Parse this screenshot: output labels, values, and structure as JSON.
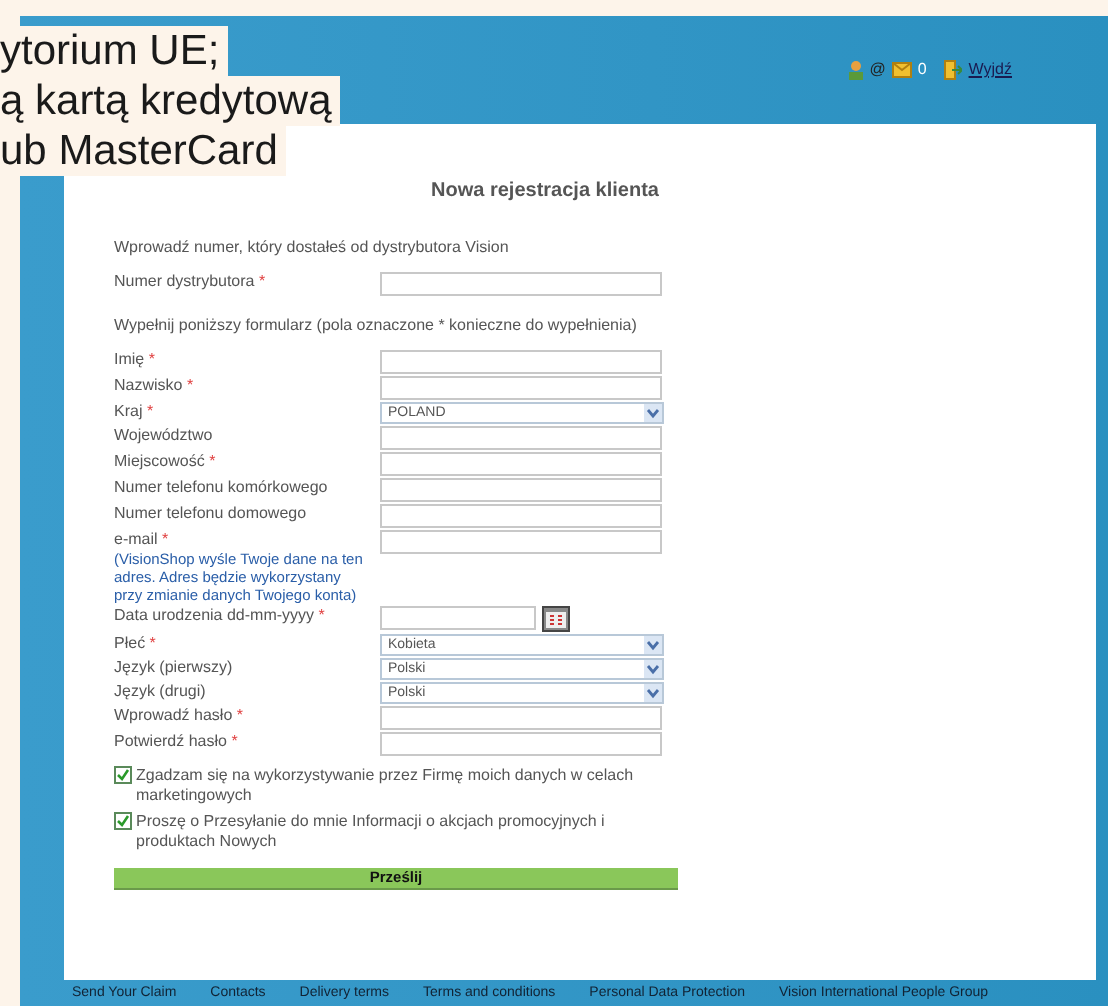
{
  "document_lines": [
    "ytorium UE;",
    "ą kartą kredytową",
    "ub MasterCard"
  ],
  "header": {
    "at_sign": "@",
    "mail_count": "0",
    "logout": "Wyjdź"
  },
  "form": {
    "title": "Nowa rejestracja klienta",
    "fields": [
      {
        "kind": "note",
        "label": "Wprowadź numer, który dostałeś od dystrybutora Vision"
      },
      {
        "kind": "text",
        "label": "Numer dystrybutora",
        "mark": "*"
      },
      {
        "kind": "note",
        "label": "Wypełnij poniższy formularz (pola oznaczone * konieczne do wypełnienia)"
      },
      {
        "kind": "text",
        "label": "Imię",
        "mark": "*"
      },
      {
        "kind": "text",
        "label": "Nazwisko",
        "mark": "*"
      },
      {
        "kind": "select",
        "label": "Kraj",
        "mark": "*",
        "value": "POLAND"
      },
      {
        "kind": "text",
        "label": "Województwo"
      },
      {
        "kind": "text",
        "label": "Miejscowość",
        "mark": "*"
      },
      {
        "kind": "text",
        "label": "Numer telefonu komórkowego"
      },
      {
        "kind": "text",
        "label": "Numer telefonu domowego"
      },
      {
        "kind": "text",
        "label": "e-mail",
        "mark": "*",
        "hint": "(VisionShop wyśle Twoje dane na ten adres. Adres będzie wykorzystany przy zmianie danych Twojego konta)"
      },
      {
        "kind": "date",
        "label": "Data urodzenia  dd-mm-yyyy",
        "mark": "*"
      },
      {
        "kind": "select",
        "label": "Płeć",
        "mark": "*",
        "value": "Kobieta"
      },
      {
        "kind": "select",
        "label": "Język (pierwszy)",
        "value": "Polski"
      },
      {
        "kind": "select",
        "label": "Język (drugi)",
        "value": "Polski"
      },
      {
        "kind": "text",
        "label": "Wprowadź hasło",
        "mark": "*"
      },
      {
        "kind": "text",
        "label": "Potwierdź hasło",
        "mark": "*"
      }
    ],
    "checkboxes": [
      {
        "label": "Zgadzam się na wykorzystywanie przez Firmę moich danych w celach marketingowych",
        "checked": true
      },
      {
        "label": "Proszę o Przesyłanie do mnie Informacji o akcjach promocyjnych i produktach Nowych",
        "checked": true
      }
    ],
    "submit": "Prześlij"
  },
  "footer_links": [
    "Send Your Claim",
    "Contacts",
    "Delivery terms",
    "Terms and conditions",
    "Personal Data Protection",
    "Vision International People Group"
  ]
}
